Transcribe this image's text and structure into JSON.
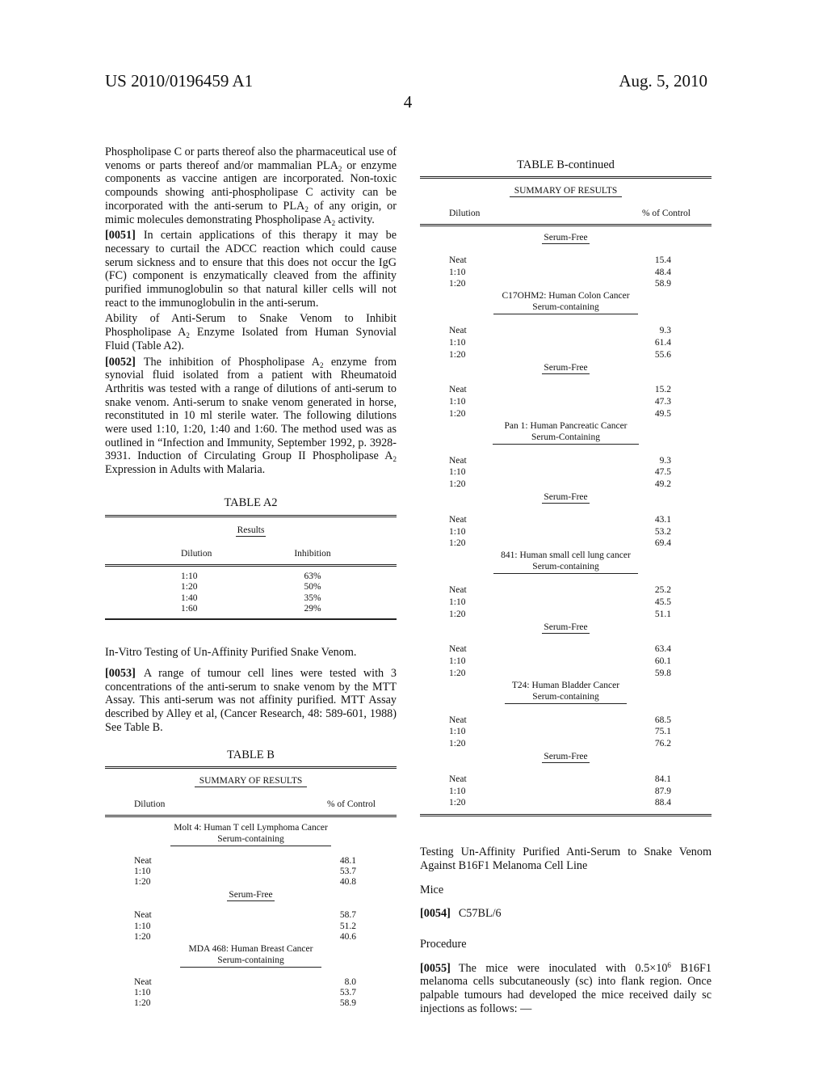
{
  "header": {
    "publication_number": "US 2010/0196459 A1",
    "date": "Aug. 5, 2010",
    "page_number": "4"
  },
  "left_column": {
    "intro_para": {
      "text_parts": [
        "Phospholipase C or parts thereof also the pharmaceutical use of venoms or parts thereof and/or mammalian PLA",
        "2",
        " or enzyme components as vaccine antigen are incorporated. Non-toxic compounds showing anti-phospholipase C activity can be incorporated with the anti-serum to PLA",
        "2",
        " of any origin, or mimic molecules demonstrating Phospholipase A",
        "2",
        " activity."
      ]
    },
    "para_0051": {
      "number": "[0051]",
      "text": "In certain applications of this therapy it may be necessary to curtail the ADCC reaction which could cause serum sickness and to ensure that this does not occur the IgG (FC) component is enzymatically cleaved from the affinity purified immunoglobulin so that natural killer cells will not react to the immunoglobulin in the anti-serum."
    },
    "heading_ability": {
      "text_parts": [
        "Ability of Anti-Serum to Snake Venom to Inhibit Phospholipase A",
        "2",
        " Enzyme Isolated from Human Synovial Fluid (Table A2)."
      ]
    },
    "para_0052": {
      "number": "[0052]",
      "text_parts": [
        "The inhibition of Phospholipase A",
        "2",
        " enzyme from synovial fluid isolated from a patient with Rheumatoid Arthritis was tested with a range of dilutions of anti-serum to snake venom. Anti-serum to snake venom generated in horse, reconstituted in 10 ml sterile water. The following dilutions were used 1:10, 1:20, 1:40 and 1:60. The method used was as outlined in “Infection and Immunity, September 1992, p. 3928-3931. Induction of Circulating Group II Phospholipase A",
        "2",
        " Expression in Adults with Malaria."
      ]
    },
    "table_a2": {
      "title": "TABLE A2",
      "subtitle": "Results",
      "columns": [
        "Dilution",
        "Inhibition"
      ],
      "rows": [
        [
          "1:10",
          "63%"
        ],
        [
          "1:20",
          "50%"
        ],
        [
          "1:40",
          "35%"
        ],
        [
          "1:60",
          "29%"
        ]
      ]
    },
    "heading_invitro": "In-Vitro Testing of Un-Affinity Purified Snake Venom.",
    "para_0053": {
      "number": "[0053]",
      "text": "A range of tumour cell lines were tested with 3 concentrations of the anti-serum to snake venom by the MTT Assay. This anti-serum was not affinity purified. MTT Assay described by Alley et al, (Cancer Research, 48: 589-601, 1988) See Table B."
    },
    "table_b": {
      "title": "TABLE B",
      "subtitle": "SUMMARY OF RESULTS",
      "columns": [
        "Dilution",
        "% of Control"
      ],
      "groups": [
        {
          "title": "Molt 4: Human T cell Lymphoma Cancer",
          "condition": "Serum-containing",
          "rows": [
            [
              "Neat",
              "48.1"
            ],
            [
              "1:10",
              "53.7"
            ],
            [
              "1:20",
              "40.8"
            ]
          ]
        },
        {
          "title": "",
          "condition": "Serum-Free",
          "rows": [
            [
              "Neat",
              "58.7"
            ],
            [
              "1:10",
              "51.2"
            ],
            [
              "1:20",
              "40.6"
            ]
          ]
        },
        {
          "title": "MDA 468: Human Breast Cancer",
          "condition": "Serum-containing",
          "rows": [
            [
              "Neat",
              "8.0"
            ],
            [
              "1:10",
              "53.7"
            ],
            [
              "1:20",
              "58.9"
            ]
          ]
        }
      ]
    }
  },
  "right_column": {
    "table_b_continued": {
      "title": "TABLE B-continued",
      "subtitle": "SUMMARY OF RESULTS",
      "columns": [
        "Dilution",
        "% of Control"
      ],
      "groups": [
        {
          "title": "",
          "condition": "Serum-Free",
          "rows": [
            [
              "Neat",
              "15.4"
            ],
            [
              "1:10",
              "48.4"
            ],
            [
              "1:20",
              "58.9"
            ]
          ]
        },
        {
          "title": "C17OHM2: Human Colon Cancer",
          "condition": "Serum-containing",
          "rows": [
            [
              "Neat",
              "9.3"
            ],
            [
              "1:10",
              "61.4"
            ],
            [
              "1:20",
              "55.6"
            ]
          ]
        },
        {
          "title": "",
          "condition": "Serum-Free",
          "rows": [
            [
              "Neat",
              "15.2"
            ],
            [
              "1:10",
              "47.3"
            ],
            [
              "1:20",
              "49.5"
            ]
          ]
        },
        {
          "title": "Pan 1: Human Pancreatic Cancer",
          "condition": "Serum-Containing",
          "rows": [
            [
              "Neat",
              "9.3"
            ],
            [
              "1:10",
              "47.5"
            ],
            [
              "1:20",
              "49.2"
            ]
          ]
        },
        {
          "title": "",
          "condition": "Serum-Free",
          "rows": [
            [
              "Neat",
              "43.1"
            ],
            [
              "1:10",
              "53.2"
            ],
            [
              "1:20",
              "69.4"
            ]
          ]
        },
        {
          "title": "841: Human small cell lung cancer",
          "condition": "Serum-containing",
          "rows": [
            [
              "Neat",
              "25.2"
            ],
            [
              "1:10",
              "45.5"
            ],
            [
              "1:20",
              "51.1"
            ]
          ]
        },
        {
          "title": "",
          "condition": "Serum-Free",
          "rows": [
            [
              "Neat",
              "63.4"
            ],
            [
              "1:10",
              "60.1"
            ],
            [
              "1:20",
              "59.8"
            ]
          ]
        },
        {
          "title": "T24: Human Bladder Cancer",
          "condition": "Serum-containing",
          "rows": [
            [
              "Neat",
              "68.5"
            ],
            [
              "1:10",
              "75.1"
            ],
            [
              "1:20",
              "76.2"
            ]
          ]
        },
        {
          "title": "",
          "condition": "Serum-Free",
          "rows": [
            [
              "Neat",
              "84.1"
            ],
            [
              "1:10",
              "87.9"
            ],
            [
              "1:20",
              "88.4"
            ]
          ]
        }
      ]
    },
    "heading_testing": "Testing Un-Affinity Purified Anti-Serum to Snake Venom Against B16F1 Melanoma Cell Line",
    "heading_mice": "Mice",
    "para_0054": {
      "number": "[0054]",
      "text": "C57BL/6"
    },
    "heading_procedure": "Procedure",
    "para_0055": {
      "number": "[0055]",
      "text_parts": [
        "The mice were inoculated with 0.5×10",
        "6",
        " B16F1 melanoma cells subcutaneously (sc) into flank region. Once palpable tumours had developed the mice received daily sc injections as follows: —"
      ]
    }
  }
}
